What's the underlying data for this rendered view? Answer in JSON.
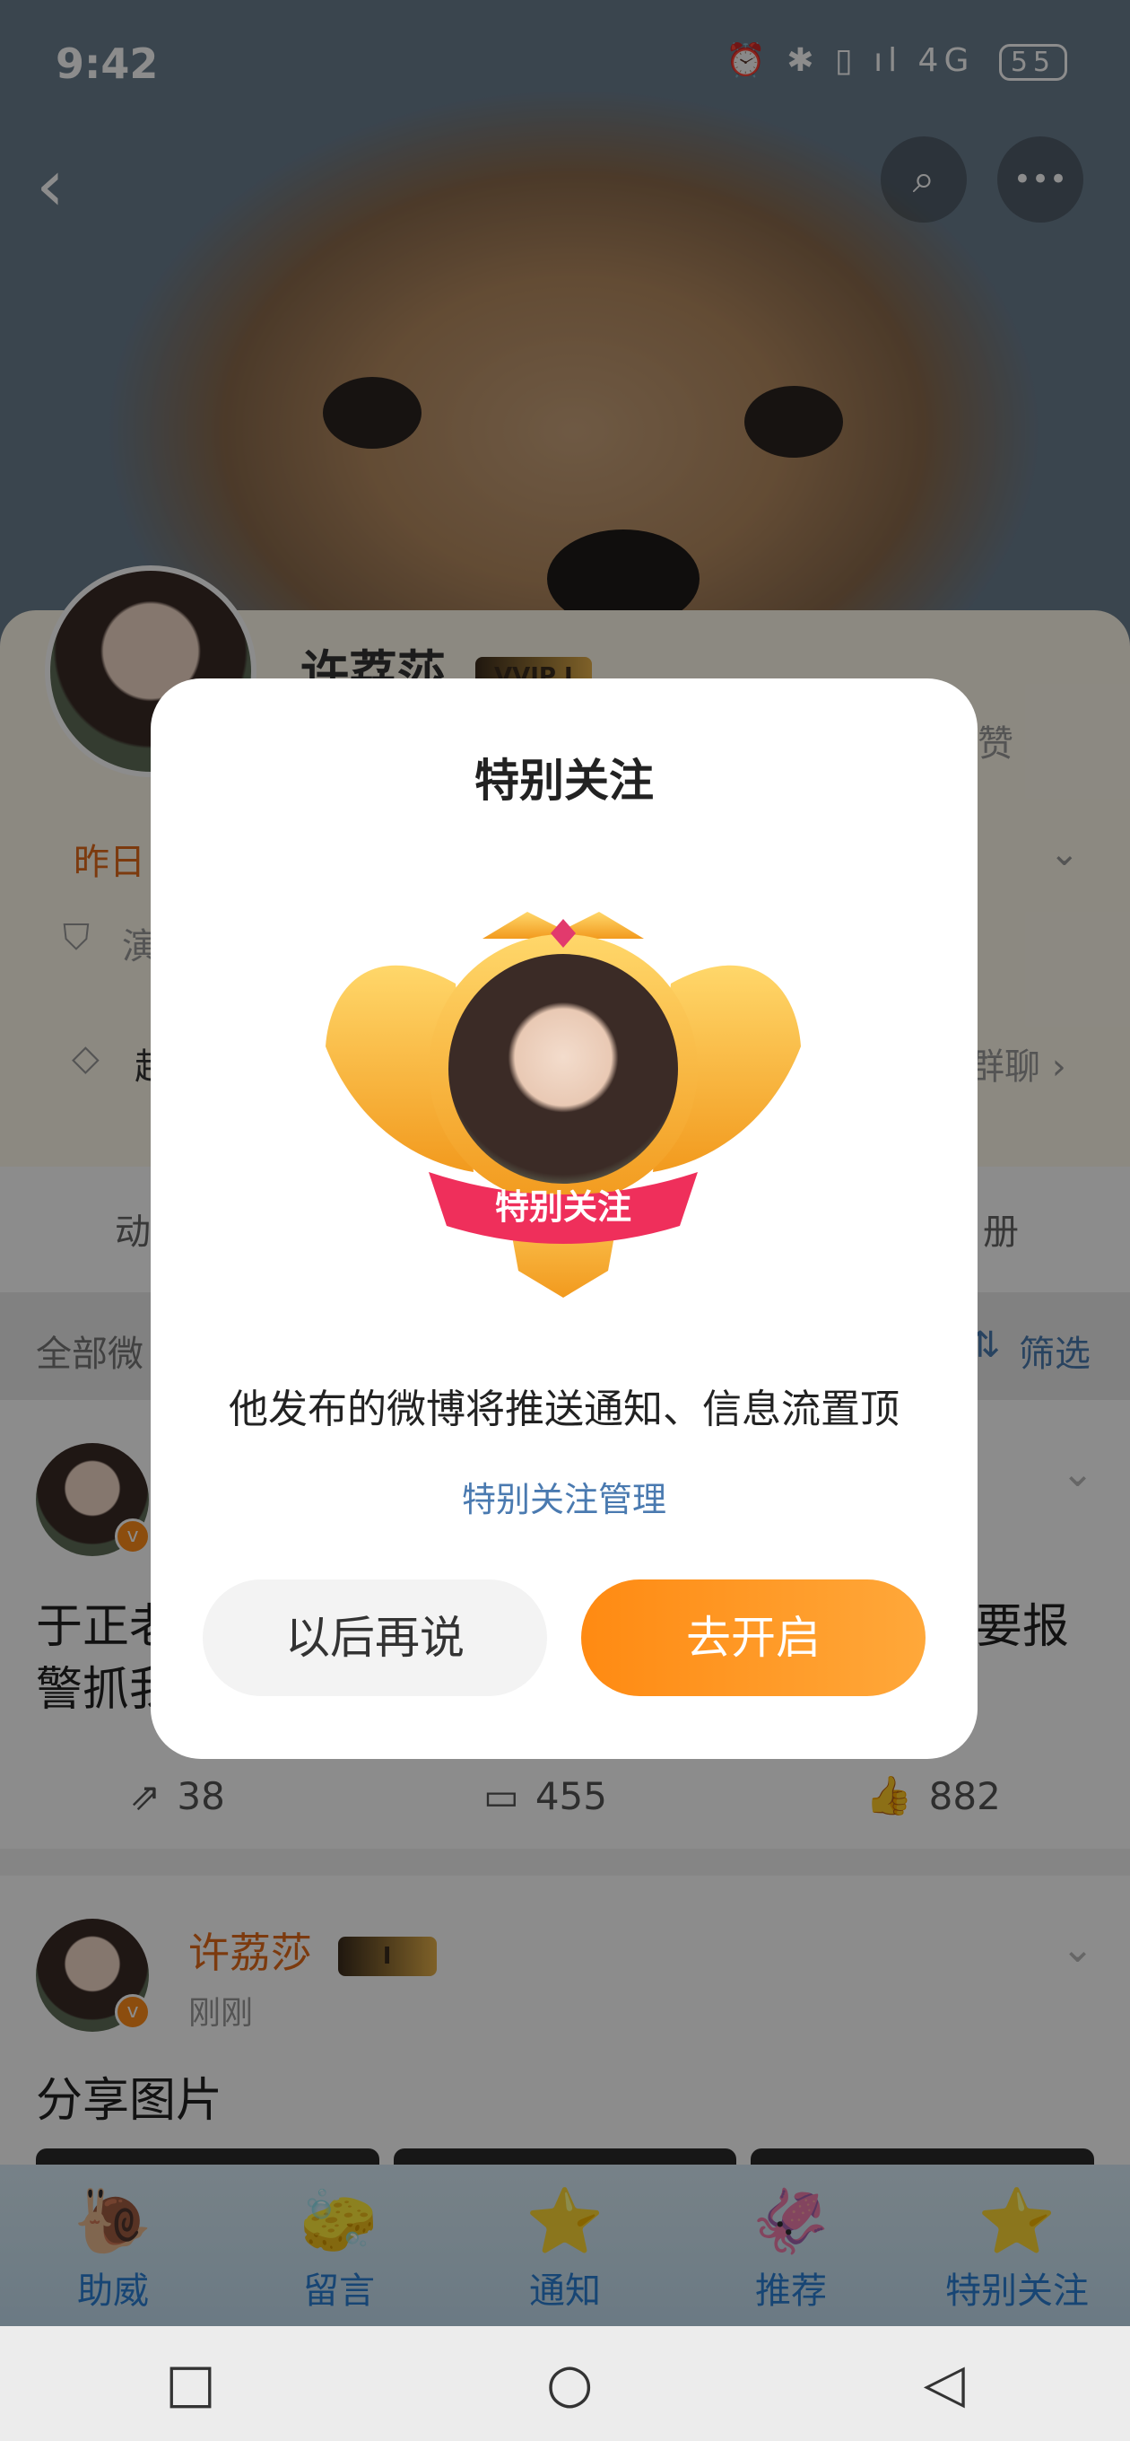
{
  "status_bar": {
    "time": "9:42",
    "icons": "⏰ ✱ ▯ ıl 4G",
    "battery": "55"
  },
  "header": {
    "back_glyph": "‹",
    "search_glyph": "⌕",
    "more_glyph": "•••"
  },
  "profile": {
    "name": "许荔莎",
    "vip_label": "VVIP I",
    "fragment_yesterday": "昨日",
    "fragment_yan": "演",
    "fragment_zan": "赞",
    "fragment_chao": "超",
    "fragment_chat": "群聊 ›",
    "fragment_dong": "动",
    "fragment_album": "册",
    "fragment_all_weibo": "全部微",
    "filter_label": "筛选"
  },
  "posts": [
    {
      "text_left": "于正老",
      "text_right": "要报",
      "text_line2": "警抓我",
      "repost_count": "38",
      "comment_count": "455",
      "like_count": "882"
    },
    {
      "author": "许荔莎",
      "badge_label": "I",
      "time": "刚刚",
      "text": "分享图片"
    }
  ],
  "toolbar": {
    "items": [
      {
        "label": "助威",
        "icon": "snail-icon"
      },
      {
        "label": "留言",
        "icon": "sponge-icon"
      },
      {
        "label": "通知",
        "icon": "starfish-icon"
      },
      {
        "label": "推荐",
        "icon": "squid-icon"
      },
      {
        "label": "特别关注",
        "icon": "starfish-icon"
      }
    ]
  },
  "navbar": {
    "recent": "□",
    "home": "○",
    "back": "◁"
  },
  "dialog": {
    "title": "特别关注",
    "ribbon_text": "特别关注",
    "description": "他发布的微博将推送通知、信息流置顶",
    "manage_link": "特别关注管理",
    "later_button": "以后再说",
    "enable_button": "去开启"
  },
  "colors": {
    "accent": "#ff8a12",
    "link": "#4a7ab0",
    "author": "#e26a1a"
  }
}
